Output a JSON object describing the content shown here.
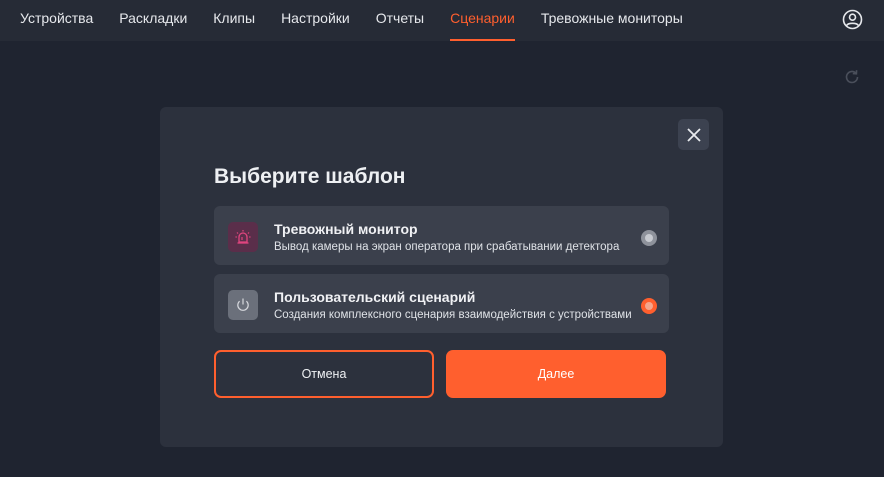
{
  "nav": {
    "tabs": [
      {
        "label": "Устройства"
      },
      {
        "label": "Раскладки"
      },
      {
        "label": "Клипы"
      },
      {
        "label": "Настройки"
      },
      {
        "label": "Отчеты"
      },
      {
        "label": "Сценарии"
      },
      {
        "label": "Тревожные мониторы"
      }
    ],
    "active_tab": "Сценарии",
    "account_icon": "user-circle-icon",
    "refresh_icon": "refresh-icon"
  },
  "modal": {
    "title": "Выберите шаблон",
    "close_icon": "close-icon",
    "options": [
      {
        "title": "Тревожный монитор",
        "description": "Вывод камеры на экран оператора при срабатывании детектора",
        "icon": "alarm-siren-icon",
        "selected": false
      },
      {
        "title": "Пользовательский сценарий",
        "description": "Создания комплексного сценария взаимодействия с устройствами",
        "icon": "power-icon",
        "selected": true
      }
    ],
    "cancel_label": "Отмена",
    "next_label": "Далее"
  },
  "colors": {
    "accent": "#ff5f2e",
    "background": "#1f2430",
    "topbar": "#262b36",
    "modal": "#2c313d",
    "option": "#3b404c"
  }
}
